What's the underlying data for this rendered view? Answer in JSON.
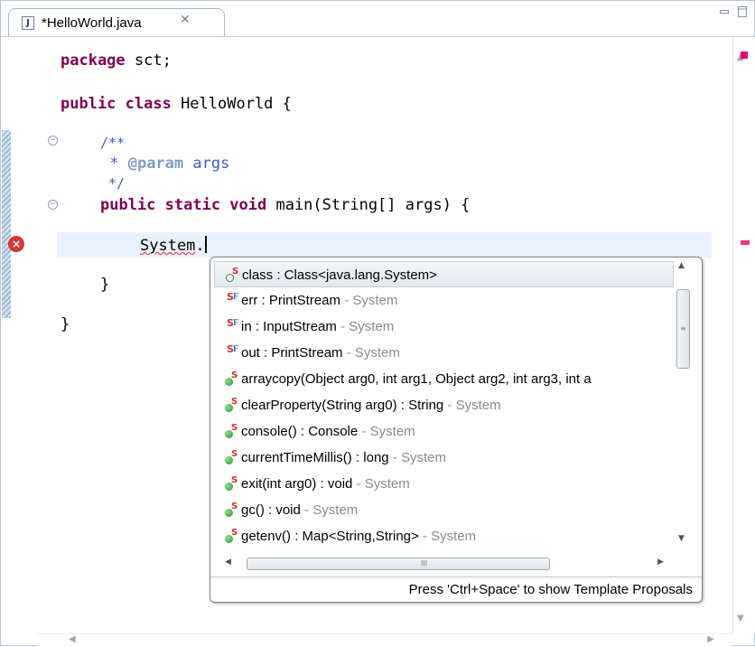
{
  "tab": {
    "title": "*HelloWorld.java",
    "file_icon": "J",
    "close_glyph": "✕"
  },
  "code": {
    "line1_kw": "package",
    "line1_rest": " sct;",
    "line2_kw": "public class",
    "line2_rest": " HelloWorld {",
    "line3": "/**",
    "line4_pre": " * ",
    "line4_tag": "@param",
    "line4_rest": " args",
    "line5": " */",
    "line6_kw": "public static void",
    "line6_rest": " main(String[] args) {",
    "line7_word": "System",
    "line7_rest": ".",
    "line8": "}",
    "line9": "}"
  },
  "popup": {
    "items": [
      {
        "icon": "field-static-hollow-icon",
        "text": "class : Class<java.lang.System>",
        "qualifier": ""
      },
      {
        "icon": "static-final-field-icon",
        "text": "err : PrintStream",
        "qualifier": " - System"
      },
      {
        "icon": "static-final-field-icon",
        "text": "in : InputStream",
        "qualifier": " - System"
      },
      {
        "icon": "static-final-field-icon",
        "text": "out : PrintStream",
        "qualifier": " - System"
      },
      {
        "icon": "static-method-icon",
        "text": "arraycopy(Object arg0, int arg1, Object arg2, int arg3, int a",
        "qualifier": ""
      },
      {
        "icon": "static-method-icon",
        "text": "clearProperty(String arg0) : String",
        "qualifier": " - System"
      },
      {
        "icon": "static-method-icon",
        "text": "console() : Console",
        "qualifier": " - System"
      },
      {
        "icon": "static-method-icon",
        "text": "currentTimeMillis() : long",
        "qualifier": " - System"
      },
      {
        "icon": "static-method-icon",
        "text": "exit(int arg0) : void",
        "qualifier": " - System"
      },
      {
        "icon": "static-method-icon",
        "text": "gc() : void",
        "qualifier": " - System"
      },
      {
        "icon": "static-method-icon",
        "text": "getenv() : Map<String,String>",
        "qualifier": " - System"
      }
    ],
    "footer": "Press 'Ctrl+Space' to show Template Proposals",
    "grip_v": "≡",
    "grip_h": "III"
  },
  "colors": {
    "keyword": "#7f0055",
    "comment": "#3f5fbf",
    "current_line": "#e8f2fe",
    "error": "#d33a3a"
  }
}
